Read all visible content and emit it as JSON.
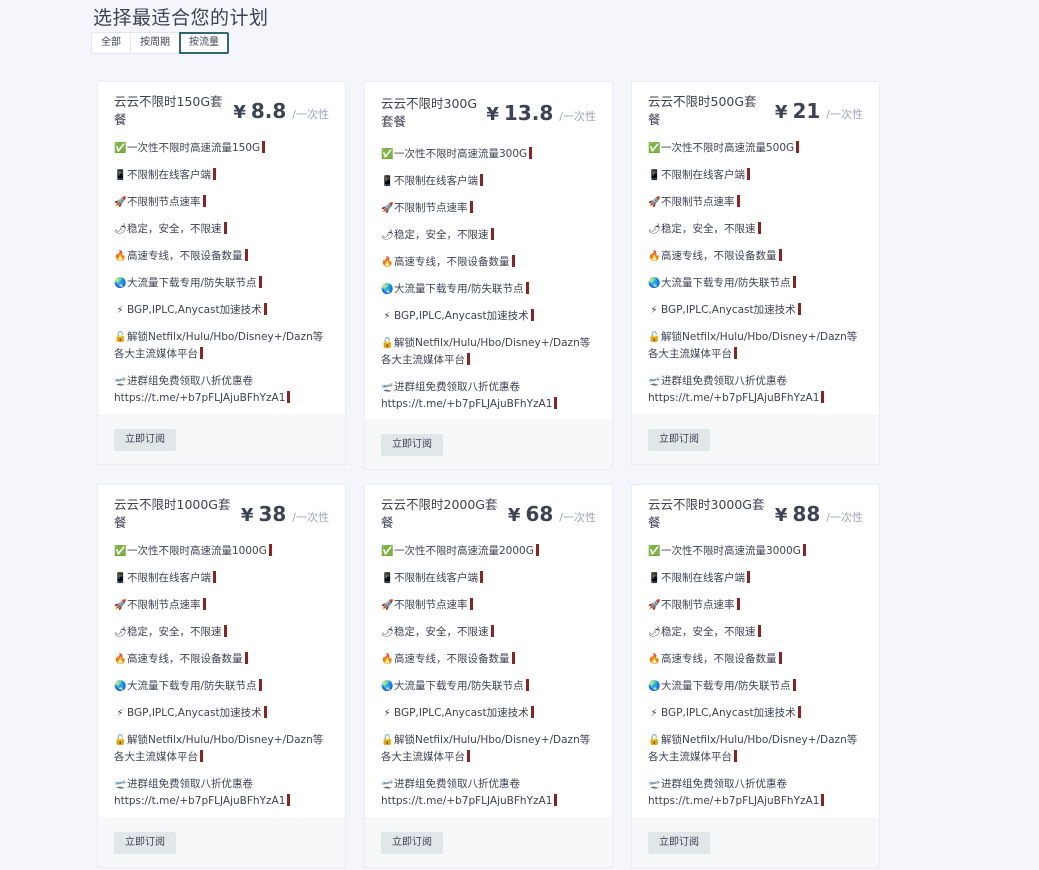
{
  "page": {
    "title": "选择最适合您的计划"
  },
  "filters": [
    {
      "label": "全部",
      "active": false
    },
    {
      "label": "按周期",
      "active": false
    },
    {
      "label": "按流量",
      "active": true
    }
  ],
  "common": {
    "price_currency": "¥",
    "price_unit": "/一次性",
    "subscribe_label": "立即订阅"
  },
  "plans": [
    {
      "name": "云云不限时150G套餐",
      "price": "8.8",
      "traffic_feature": "一次性不限时高速流量150G"
    },
    {
      "name": "云云不限时300G套餐",
      "price": "13.8",
      "traffic_feature": "一次性不限时高速流量300G"
    },
    {
      "name": "云云不限时500G套餐",
      "price": "21",
      "traffic_feature": "一次性不限时高速流量500G"
    },
    {
      "name": "云云不限时1000G套餐",
      "price": "38",
      "traffic_feature": "一次性不限时高速流量1000G"
    },
    {
      "name": "云云不限时2000G套餐",
      "price": "68",
      "traffic_feature": "一次性不限时高速流量2000G"
    },
    {
      "name": "云云不限时3000G套餐",
      "price": "88",
      "traffic_feature": "一次性不限时高速流量3000G"
    }
  ],
  "features": [
    {
      "icon": "check-mark-icon",
      "glyph": "✅",
      "text": ""
    },
    {
      "icon": "mobile-phone-icon",
      "glyph": "📱",
      "text": "不限制在线客户端"
    },
    {
      "icon": "rocket-icon",
      "glyph": "🚀",
      "text": "不限制节点速率"
    },
    {
      "icon": "chili-icon",
      "glyph": "🌶",
      "text": "稳定，安全，不限速"
    },
    {
      "icon": "fire-icon",
      "glyph": "🔥",
      "text": "高速专线，不限设备数量"
    },
    {
      "icon": "globe-icon",
      "glyph": "🌏",
      "text": "大流量下载专用/防失联节点"
    },
    {
      "icon": "lightning-icon",
      "glyph": "⚡",
      "text": "BGP,IPLC,Anycast加速技术"
    },
    {
      "icon": "lock-icon",
      "glyph": "🔓",
      "text": "解锁Netfilx/Hulu/Hbo/Disney+/Dazn等各大主流媒体平台"
    },
    {
      "icon": "airplane-icon",
      "glyph": "🛫",
      "text": "进群组免费领取八折优惠卷https://t.me/+b7pFLJAjuBFhYzA1"
    }
  ]
}
